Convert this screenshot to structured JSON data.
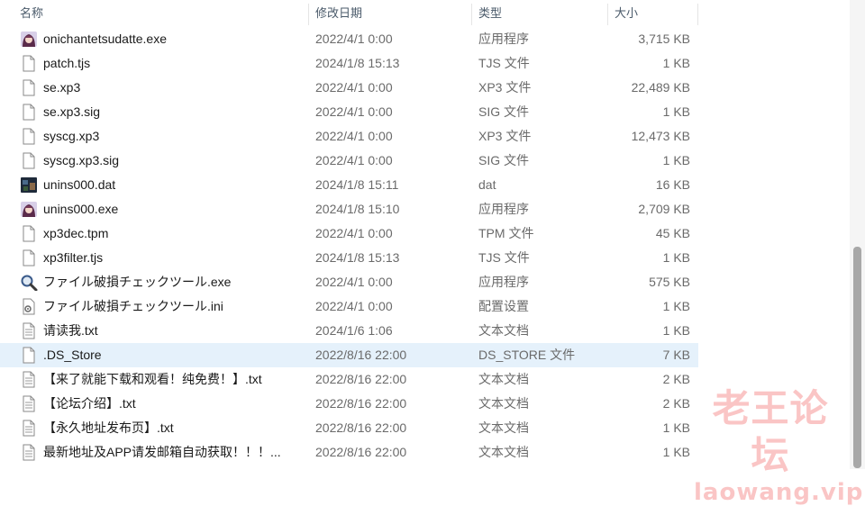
{
  "columns": {
    "name": "名称",
    "date": "修改日期",
    "type": "类型",
    "size": "大小"
  },
  "files": [
    {
      "name": "onichantetsudatte.exe",
      "date": "2022/4/1 0:00",
      "type": "应用程序",
      "size": "3,715 KB",
      "icon": "app-icon"
    },
    {
      "name": "patch.tjs",
      "date": "2024/1/8 15:13",
      "type": "TJS 文件",
      "size": "1 KB",
      "icon": "file-icon"
    },
    {
      "name": "se.xp3",
      "date": "2022/4/1 0:00",
      "type": "XP3 文件",
      "size": "22,489 KB",
      "icon": "file-icon"
    },
    {
      "name": "se.xp3.sig",
      "date": "2022/4/1 0:00",
      "type": "SIG 文件",
      "size": "1 KB",
      "icon": "file-icon"
    },
    {
      "name": "syscg.xp3",
      "date": "2022/4/1 0:00",
      "type": "XP3 文件",
      "size": "12,473 KB",
      "icon": "file-icon"
    },
    {
      "name": "syscg.xp3.sig",
      "date": "2022/4/1 0:00",
      "type": "SIG 文件",
      "size": "1 KB",
      "icon": "file-icon"
    },
    {
      "name": "unins000.dat",
      "date": "2024/1/8 15:11",
      "type": "dat",
      "size": "16 KB",
      "icon": "dat-icon"
    },
    {
      "name": "unins000.exe",
      "date": "2024/1/8 15:10",
      "type": "应用程序",
      "size": "2,709 KB",
      "icon": "app-icon"
    },
    {
      "name": "xp3dec.tpm",
      "date": "2022/4/1 0:00",
      "type": "TPM 文件",
      "size": "45 KB",
      "icon": "file-icon"
    },
    {
      "name": "xp3filter.tjs",
      "date": "2024/1/8 15:13",
      "type": "TJS 文件",
      "size": "1 KB",
      "icon": "file-icon"
    },
    {
      "name": "ファイル破損チェックツール.exe",
      "date": "2022/4/1 0:00",
      "type": "应用程序",
      "size": "575 KB",
      "icon": "magnifier-icon"
    },
    {
      "name": "ファイル破損チェックツール.ini",
      "date": "2022/4/1 0:00",
      "type": "配置设置",
      "size": "1 KB",
      "icon": "settings-file-icon"
    },
    {
      "name": "请读我.txt",
      "date": "2024/1/6 1:06",
      "type": "文本文档",
      "size": "1 KB",
      "icon": "text-file-icon"
    },
    {
      "name": ".DS_Store",
      "date": "2022/8/16 22:00",
      "type": "DS_STORE 文件",
      "size": "7 KB",
      "icon": "file-icon",
      "selected": true
    },
    {
      "name": "【来了就能下载和观看！纯免费！】.txt",
      "date": "2022/8/16 22:00",
      "type": "文本文档",
      "size": "2 KB",
      "icon": "text-file-icon"
    },
    {
      "name": "【论坛介绍】.txt",
      "date": "2022/8/16 22:00",
      "type": "文本文档",
      "size": "2 KB",
      "icon": "text-file-icon"
    },
    {
      "name": "【永久地址发布页】.txt",
      "date": "2022/8/16 22:00",
      "type": "文本文档",
      "size": "1 KB",
      "icon": "text-file-icon"
    },
    {
      "name": "最新地址及APP请发邮箱自动获取！！！...",
      "date": "2022/8/16 22:00",
      "type": "文本文档",
      "size": "1 KB",
      "icon": "text-file-icon"
    }
  ],
  "watermark": {
    "cn": "老王论坛",
    "en": "laowang.vip"
  },
  "colors": {
    "selected_row": "#e5f1fb",
    "header_text": "#4a5a6a",
    "watermark": "#f5a0a0"
  }
}
